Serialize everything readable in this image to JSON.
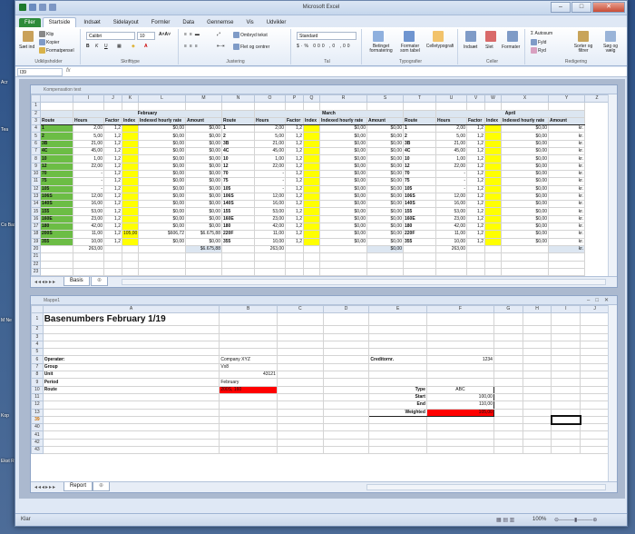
{
  "desktop": {
    "icons": [
      "Acr",
      "Tea",
      "Co Bas",
      "M Ne",
      "Kop",
      "Ekst Re"
    ]
  },
  "window": {
    "title": "Microsoft Excel",
    "btn_min": "–",
    "btn_max": "□",
    "btn_close": "✕"
  },
  "ribbon_tabs": [
    "Filer",
    "Startside",
    "Indsæt",
    "Sidelayout",
    "Formler",
    "Data",
    "Gennemse",
    "Vis",
    "Udvikler"
  ],
  "ribbon": {
    "paste": "Sæt ind",
    "cut": "Klip",
    "copy": "Kopier",
    "format_painter": "Formatpensel",
    "clipboard": "Udklipsholder",
    "font_name": "Calibri",
    "font_size": "10",
    "font_group": "Skrifttype",
    "wrap": "Ombryd tekst",
    "merge": "Flet og centrer",
    "align_group": "Justering",
    "number_format": "Standard",
    "number_group": "Tal",
    "cond_format": "Betinget formatering",
    "format_table": "Formater som tabel",
    "cell_styles": "Celletypografi",
    "styles_group": "Typografier",
    "insert": "Indsæt",
    "delete": "Slet",
    "format": "Formater",
    "cells_group": "Celler",
    "autosum": "Autosum",
    "fill": "Fyld",
    "clear": "Ryd",
    "sort": "Sorter og filtrer",
    "find": "Søg og vælg",
    "edit_group": "Redigering"
  },
  "formula_bar": {
    "name_box": "I39",
    "fx": "fx"
  },
  "top_sheet": {
    "title": "Kompensation test",
    "col_headers": [
      "I",
      "J",
      "K",
      "L",
      "M",
      "N",
      "O",
      "P",
      "Q",
      "R",
      "S",
      "T",
      "U",
      "V",
      "W",
      "X",
      "Y",
      "Z"
    ],
    "months": [
      "February",
      "March",
      "April"
    ],
    "headers": [
      "Route",
      "Hours",
      "Factor",
      "Index",
      "Indexed hourly rate",
      "Amount"
    ],
    "routes": [
      "1",
      "2",
      "3B",
      "4C",
      "10",
      "12",
      "70",
      "75",
      "105",
      "106S",
      "140S",
      "155",
      "160E",
      "180",
      "200S",
      "355"
    ],
    "rows": [
      {
        "r": "1",
        "h": "2,00",
        "f": "1,2",
        "i": "",
        "ir": "$0,00",
        "a": "$0,00",
        "h2": "2,00",
        "a2": "$0,00",
        "h3": "2,00",
        "a3": "kr."
      },
      {
        "r": "2",
        "h": "5,00",
        "f": "1,2",
        "i": "",
        "ir": "$0,00",
        "a": "$0,00",
        "h2": "5,00",
        "a2": "$0,00",
        "h3": "5,00",
        "a3": "kr."
      },
      {
        "r": "3B",
        "h": "21,00",
        "f": "1,2",
        "i": "",
        "ir": "$0,00",
        "a": "$0,00",
        "h2": "21,00",
        "a2": "$0,00",
        "h3": "21,00",
        "a3": "kr."
      },
      {
        "r": "4C",
        "h": "45,00",
        "f": "1,2",
        "i": "",
        "ir": "$0,00",
        "a": "$0,00",
        "h2": "45,00",
        "a2": "$0,00",
        "h3": "45,00",
        "a3": "kr."
      },
      {
        "r": "10",
        "h": "1,00",
        "f": "1,2",
        "i": "",
        "ir": "$0,00",
        "a": "$0,00",
        "h2": "1,00",
        "a2": "$0,00",
        "h3": "1,00",
        "a3": "kr."
      },
      {
        "r": "12",
        "h": "22,00",
        "f": "1,2",
        "i": "",
        "ir": "$0,00",
        "a": "$0,00",
        "h2": "22,00",
        "a2": "$0,00",
        "h3": "22,00",
        "a3": "kr."
      },
      {
        "r": "70",
        "h": "-",
        "f": "1,2",
        "i": "",
        "ir": "$0,00",
        "a": "$0,00",
        "h2": "-",
        "a2": "$0,00",
        "h3": "-",
        "a3": "kr."
      },
      {
        "r": "75",
        "h": "-",
        "f": "1,2",
        "i": "",
        "ir": "$0,00",
        "a": "$0,00",
        "h2": "-",
        "a2": "$0,00",
        "h3": "-",
        "a3": "kr."
      },
      {
        "r": "105",
        "h": "-",
        "f": "1,2",
        "i": "",
        "ir": "$0,00",
        "a": "$0,00",
        "h2": "-",
        "a2": "$0,00",
        "h3": "-",
        "a3": "kr."
      },
      {
        "r": "106S",
        "h": "12,00",
        "f": "1,2",
        "i": "",
        "ir": "$0,00",
        "a": "$0,00",
        "h2": "12,00",
        "a2": "$0,00",
        "h3": "12,00",
        "a3": "kr."
      },
      {
        "r": "140S",
        "h": "16,00",
        "f": "1,2",
        "i": "",
        "ir": "$0,00",
        "a": "$0,00",
        "h2": "16,00",
        "a2": "$0,00",
        "h3": "16,00",
        "a3": "kr."
      },
      {
        "r": "155",
        "h": "53,00",
        "f": "1,2",
        "i": "",
        "ir": "$0,00",
        "a": "$0,00",
        "h2": "53,00",
        "a2": "$0,00",
        "h3": "53,00",
        "a3": "kr."
      },
      {
        "r": "160E",
        "h": "23,00",
        "f": "1,2",
        "i": "",
        "ir": "$0,00",
        "a": "$0,00",
        "h2": "23,00",
        "a2": "$0,00",
        "h3": "23,00",
        "a3": "kr."
      },
      {
        "r": "180",
        "h": "42,00",
        "f": "1,2",
        "i": "",
        "ir": "$0,00",
        "a": "$0,00",
        "h2": "42,00",
        "a2": "$0,00",
        "h3": "42,00",
        "a3": "kr."
      },
      {
        "r": "200S",
        "h": "11,00",
        "f": "1,2",
        "i": "105,00",
        "ir": "$606,72",
        "a": "$6.675,88",
        "h2": "11,00",
        "a2": "$0,00",
        "h3": "11,00",
        "a3": "kr."
      },
      {
        "r": "355",
        "h": "10,00",
        "f": "1,2",
        "i": "",
        "ir": "$0,00",
        "a": "$0,00",
        "h2": "10,00",
        "a2": "$0,00",
        "h3": "10,00",
        "a3": "kr."
      }
    ],
    "routes_mar": [
      "1",
      "2",
      "3B",
      "4C",
      "10",
      "12",
      "70",
      "75",
      "105",
      "106S",
      "140S",
      "155",
      "160E",
      "180",
      "220F",
      "355"
    ],
    "routes_apr": [
      "1",
      "2",
      "3B",
      "4C",
      "10",
      "12",
      "70",
      "75",
      "105",
      "106S",
      "140S",
      "155",
      "160E",
      "180",
      "220F",
      "355"
    ],
    "total_hours": "263,00",
    "total_amount": "$6.675,88",
    "total_amount2": "$0,00",
    "total_hours3": "263,00",
    "total_amount3": "kr.",
    "tab": "Basis"
  },
  "bottom_sheet": {
    "title": "Mappe1",
    "col_headers": [
      "A",
      "B",
      "C",
      "D",
      "E",
      "F",
      "G",
      "H",
      "I",
      "J"
    ],
    "heading": "Basenumbers February 1/19",
    "labels": [
      "Operatør:",
      "Group",
      "Unit",
      "Period",
      "Route"
    ],
    "values": [
      "Company XYZ",
      "Vx8",
      "43121",
      "February",
      "200S, 160"
    ],
    "creditor_label": "Creditornr.",
    "creditor_value": "1234",
    "type_label": "Type",
    "type_value": "ABC",
    "start_label": "Start",
    "start_value": "100,00",
    "end_label": "End",
    "end_value": "110,00",
    "weighted_label": "Weighted",
    "weighted_value": "105,00",
    "tab": "Report"
  },
  "status": {
    "ready": "Klar",
    "zoom": "100%"
  }
}
